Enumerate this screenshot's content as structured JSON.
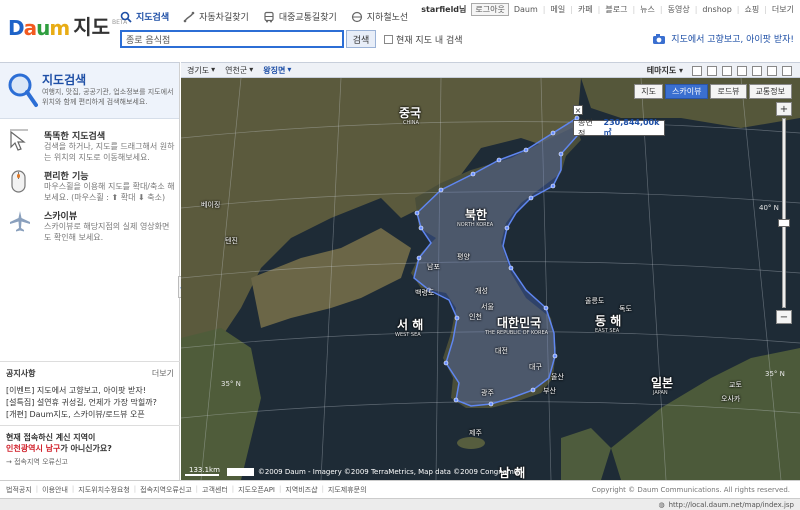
{
  "header": {
    "logo_daum": [
      "D",
      "a",
      "u",
      "m"
    ],
    "logo_map": "지도",
    "logo_beta": "BETA",
    "nav": [
      {
        "label": "지도검색",
        "icon": "search-icon",
        "active": true
      },
      {
        "label": "자동차길찾기",
        "icon": "car-route-icon",
        "active": false
      },
      {
        "label": "대중교통길찾기",
        "icon": "bus-icon",
        "active": false
      },
      {
        "label": "지하철노선",
        "icon": "subway-icon",
        "active": false
      }
    ],
    "search_value": "종로 음식점",
    "search_button": "검색",
    "search_in_map": "현재 지도 내 검색",
    "util": {
      "user": "starfield님",
      "logout": "로그아웃",
      "links": [
        "Daum",
        "메일",
        "카페",
        "블로그",
        "뉴스",
        "동영상",
        "dnshop",
        "쇼핑",
        "더보기"
      ]
    },
    "promo": "지도에서 고향보고, 아이팟 받자!"
  },
  "left": {
    "title": "지도검색",
    "desc": "여행지, 맛집, 공공기관, 업소정보를 지도에서 위치와 함께 편리하게 검색해보세요.",
    "features": [
      {
        "title": "똑똑한 지도검색",
        "desc": "검색을 하거나, 지도를 드래그해서 원하는 위치의 지도로 이동해보세요.",
        "icon": "cursor-icon"
      },
      {
        "title": "편리한 기능",
        "desc": "마우스휠을 이용해 지도를 확대/축소 해보세요. (마우스휠 : ⬆ 확대 ⬇ 축소)",
        "icon": "mouse-icon"
      },
      {
        "title": "스카이뷰",
        "desc": "스카이뷰로 해당지점의 실제 영상화면도 확인해 보세요.",
        "icon": "airplane-icon"
      }
    ],
    "notice": {
      "title": "공지사항",
      "more": "더보기",
      "items": [
        "[이벤트] 지도에서 고향보고, 아이팟 받자!",
        "[설특집] 설연휴 귀성길, 언제가 가장 막힐까?",
        "[개편] Daum지도, 스카이뷰/로드뷰 오픈"
      ]
    },
    "region": {
      "q1": "현재 접속하신 계신 지역이",
      "q2_highlight": "인천광역시 남구",
      "q2_rest": "가 아니신가요?",
      "report": "→ 접속지역 오류신고"
    }
  },
  "mapbar": {
    "crumbs": [
      "경기도",
      "연천군",
      "왕징면"
    ],
    "theme": "테마지도"
  },
  "map": {
    "modes": [
      {
        "label": "지도",
        "on": false
      },
      {
        "label": "스카이뷰",
        "on": true
      },
      {
        "label": "로드뷰",
        "on": false
      },
      {
        "label": "교통정보",
        "on": false
      }
    ],
    "zoom_in": "+",
    "zoom_out": "−",
    "area_label": "총면적",
    "area_value": "230,844,00k㎡",
    "close": "×",
    "labels": {
      "china": "중국",
      "china_en": "CHINA",
      "nk": "북한",
      "nk_en": "NORTH KOREA",
      "sk": "대한민국",
      "sk_en": "THE REPUBLIC OF KOREA",
      "yellow_sea": "서 해",
      "yellow_sea_en": "WEST SEA",
      "east_sea": "동 해",
      "east_sea_en": "EAST SEA",
      "south_sea": "남 해",
      "japan": "일본",
      "japan_en": "JAPAN",
      "beijing": "베이징",
      "tianjin": "텐진",
      "pyongyang": "평양",
      "nampo": "남포",
      "kaesong": "개성",
      "seoul": "서울",
      "incheon": "인천",
      "baengnyeong": "백령도",
      "daejeon": "대전",
      "daegu": "대구",
      "ulsan": "울산",
      "busan": "부산",
      "gwangju": "광주",
      "jeju": "제주",
      "ulleung": "울릉도",
      "dokdo": "독도",
      "kyoto": "교토",
      "osaka": "오사카"
    },
    "lat_labels": [
      "40° N",
      "35° N",
      "35° N"
    ],
    "scale": "133.1km",
    "copyright_logo": "Daum",
    "copyright": "©2009 Daum - Imagery ©2009 TerraMetrics, Map data ©2009 Congnamul"
  },
  "footer": {
    "links": [
      "법적공지",
      "이용안내",
      "지도위치수정요청",
      "접속지역오류신고",
      "고객센터",
      "지도오픈API",
      "지역비즈샵",
      "지도제휴문의"
    ],
    "copyright": "Copyright © Daum Communications. All rights reserved.",
    "status_url": "http://local.daum.net/map/index.jsp"
  }
}
